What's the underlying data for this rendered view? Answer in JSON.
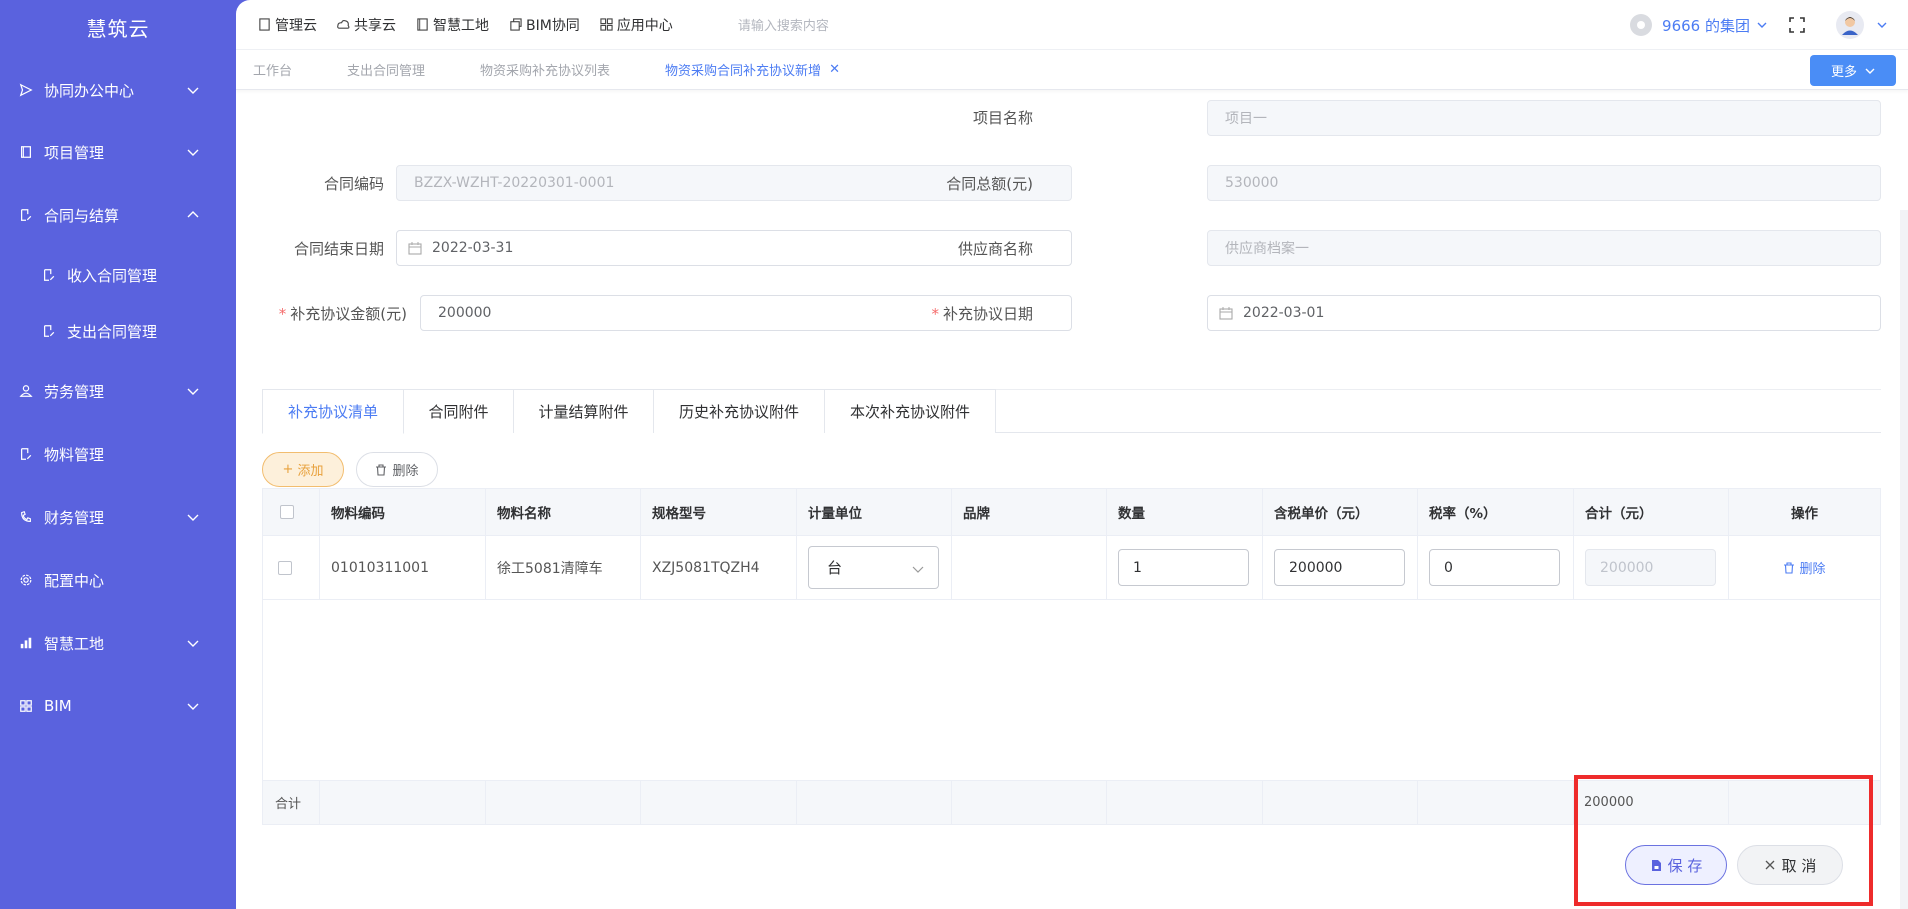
{
  "app": {
    "logo": "慧筑云"
  },
  "sidebar": {
    "items": [
      {
        "label": "协同办公中心",
        "icon": "send-icon",
        "expanded": false
      },
      {
        "label": "项目管理",
        "icon": "book-icon",
        "expanded": false
      },
      {
        "label": "合同与结算",
        "icon": "edit-doc-icon",
        "expanded": true
      },
      {
        "label": "收入合同管理",
        "icon": "edit-doc-icon"
      },
      {
        "label": "支出合同管理",
        "icon": "edit-doc-icon"
      },
      {
        "label": "劳务管理",
        "icon": "worker-icon",
        "expanded": false
      },
      {
        "label": "物料管理",
        "icon": "edit-doc-icon"
      },
      {
        "label": "财务管理",
        "icon": "finance-icon",
        "expanded": false
      },
      {
        "label": "配置中心",
        "icon": "gear-icon"
      },
      {
        "label": "智慧工地",
        "icon": "bar-chart-icon",
        "expanded": false
      },
      {
        "label": "BIM",
        "icon": "grid-icon",
        "expanded": false
      }
    ]
  },
  "topnav": {
    "items": [
      "管理云",
      "共享云",
      "智慧工地",
      "BIM协同",
      "应用中心"
    ],
    "search_placeholder": "请输入搜索内容",
    "org": "9666 的集团"
  },
  "tabs": {
    "items": [
      "工作台",
      "支出合同管理",
      "物资采购补充协议列表"
    ],
    "active": "物资采购合同补充协议新增",
    "more": "更多"
  },
  "form": {
    "project_name": {
      "label": "项目名称",
      "value": "项目一"
    },
    "contract_code": {
      "label": "合同编码",
      "value": "BZZX-WZHT-20220301-0001"
    },
    "contract_total": {
      "label": "合同总额(元)",
      "value": "530000"
    },
    "end_date": {
      "label": "合同结束日期",
      "value": "2022-03-31"
    },
    "supplier": {
      "label": "供应商名称",
      "value": "供应商档案一"
    },
    "supp_amount": {
      "label": "补充协议金额(元)",
      "value": "200000",
      "required": "*"
    },
    "supp_date": {
      "label": "补充协议日期",
      "value": "2022-03-01",
      "required": "*"
    }
  },
  "inner_tabs": [
    "补充协议清单",
    "合同附件",
    "计量结算附件",
    "历史补充协议附件",
    "本次补充协议附件"
  ],
  "actions": {
    "add": "添加",
    "add_icon": "+",
    "delete": "删除"
  },
  "table": {
    "headers": [
      "物料编码",
      "物料名称",
      "规格型号",
      "计量单位",
      "品牌",
      "数量",
      "含税单价（元）",
      "税率（%）",
      "合计（元）",
      "操作"
    ],
    "row": {
      "code": "01010311001",
      "name": "徐工5081清障车",
      "spec": "XZJ5081TQZH4",
      "unit": "台",
      "brand": "",
      "qty": "1",
      "price": "200000",
      "tax": "0",
      "total": "200000",
      "op": "删除"
    },
    "footer": {
      "label": "合计",
      "total": "200000"
    }
  },
  "buttons": {
    "save": "保 存",
    "cancel": "取 消"
  },
  "colors": {
    "sidebar": "#5a62de",
    "accent": "#4c7cf3",
    "highlight": "#ee2b2b"
  }
}
